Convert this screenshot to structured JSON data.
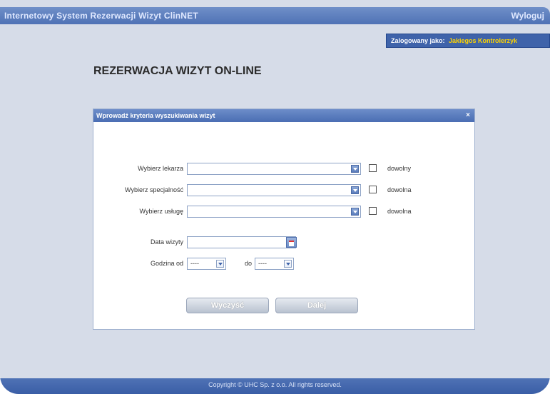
{
  "app": {
    "title": "Internetowy System Rezerwacji Wizyt ClinNET",
    "logout_label": "Wyloguj"
  },
  "login_info": {
    "label": "Zalogowany jako:",
    "user": "Jakiegos Kontrolerzyk"
  },
  "page_title": "REZERWACJA WIZYT ON-LINE",
  "panel": {
    "header": "Wprowadź kryteria wyszukiwania wizyt",
    "close_glyph": "×",
    "fields": {
      "doctor": {
        "label": "Wybierz lekarza",
        "value": "",
        "any_label": "dowolny"
      },
      "specialty": {
        "label": "Wybierz specjalność",
        "value": "",
        "any_label": "dowolna"
      },
      "service": {
        "label": "Wybierz usługę",
        "value": "",
        "any_label": "dowolna"
      },
      "date": {
        "label": "Data wizyty",
        "value": ""
      },
      "hour": {
        "label": "Godzina od",
        "from_value": "----",
        "to_label": "do",
        "to_value": "----"
      }
    },
    "buttons": {
      "clear": "Wyczyść",
      "next": "Dalej"
    }
  },
  "footer": "Copyright © UHC Sp. z o.o. All rights reserved.",
  "colors": {
    "accent": "#4f72b5",
    "user_highlight": "#ffd400",
    "background": "#d6dce8"
  }
}
